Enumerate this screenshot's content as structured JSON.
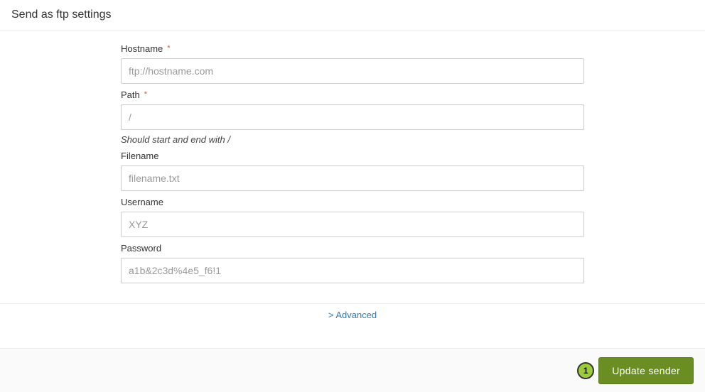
{
  "page": {
    "title": "Send as ftp settings"
  },
  "fields": {
    "hostname": {
      "label": "Hostname",
      "required_mark": "*",
      "placeholder": "ftp://hostname.com",
      "value": ""
    },
    "path": {
      "label": "Path",
      "required_mark": "*",
      "placeholder": "/",
      "value": "",
      "hint": "Should start and end with /"
    },
    "filename": {
      "label": "Filename",
      "placeholder": "filename.txt",
      "value": ""
    },
    "username": {
      "label": "Username",
      "placeholder": "XYZ",
      "value": ""
    },
    "password": {
      "label": "Password",
      "placeholder": "a1b&2c3d%4e5_f6!1",
      "value": ""
    }
  },
  "advanced": {
    "label": "> Advanced"
  },
  "footer": {
    "badge_count": "1",
    "update_label": "Update sender"
  },
  "colors": {
    "accent": "#6b8e23",
    "badge": "#9ccc3c",
    "link": "#337ab7",
    "danger": "#d9534f"
  }
}
